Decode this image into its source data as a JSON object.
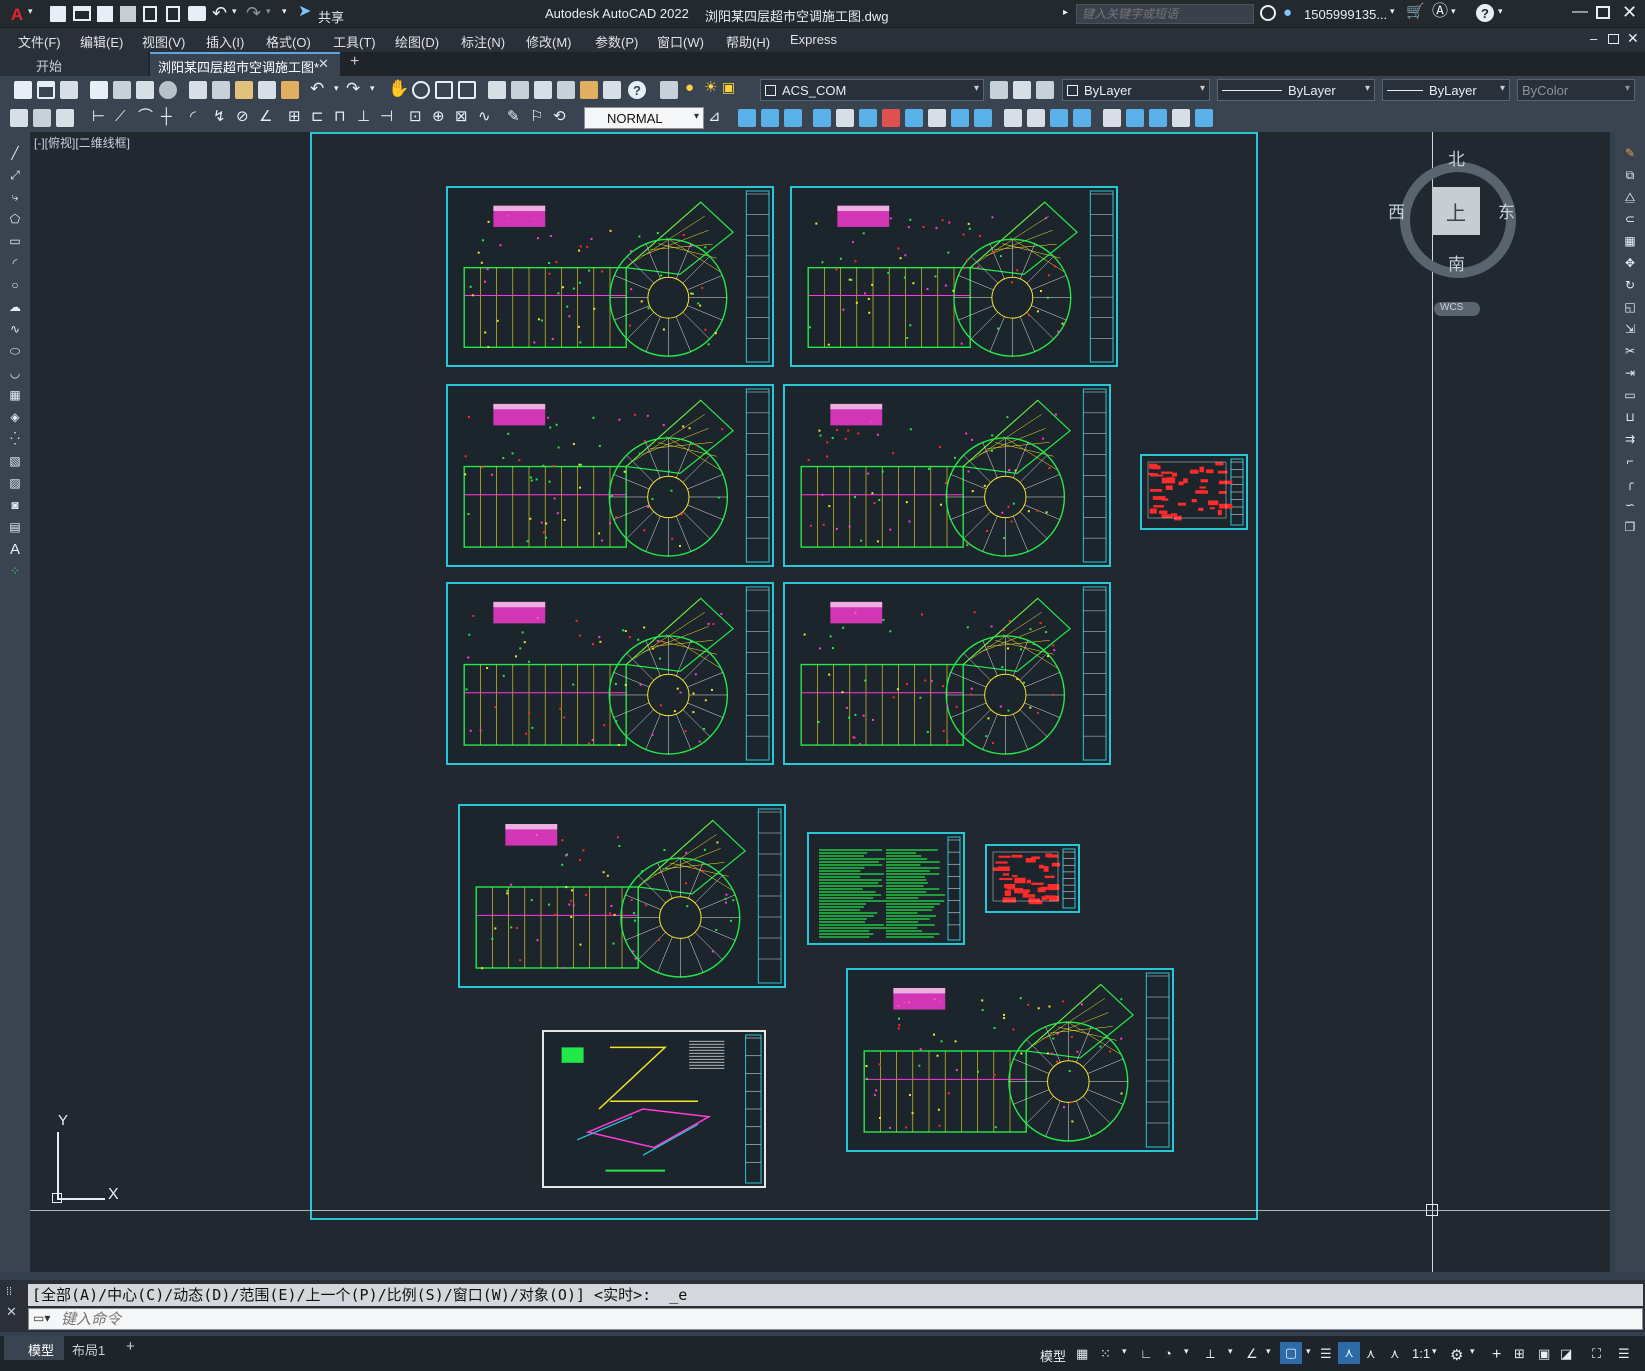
{
  "titlebar": {
    "app_logo": "A",
    "share_label": "共享",
    "app_title": "Autodesk AutoCAD 2022",
    "file_title": "浏阳某四层超市空调施工图.dwg",
    "search_placeholder": "键入关键字或短语",
    "user": "1505999135...",
    "icons": [
      "new-icon",
      "open-icon",
      "save-icon",
      "saveas-icon",
      "print-icon",
      "undo-icon",
      "redo-icon",
      "share-icon",
      "search-icon",
      "user-icon",
      "cart-icon",
      "help-icon",
      "minimize-icon",
      "maximize-icon",
      "close-icon"
    ]
  },
  "menubar": {
    "items": [
      "文件(F)",
      "编辑(E)",
      "视图(V)",
      "插入(I)",
      "格式(O)",
      "工具(T)",
      "绘图(D)",
      "标注(N)",
      "修改(M)",
      "参数(P)",
      "窗口(W)",
      "帮助(H)",
      "Express"
    ]
  },
  "tabs": {
    "start": "开始",
    "active": "浏阳某四层超市空调施工图*",
    "add": "+"
  },
  "toolbar": {
    "layer": "ACS_COM",
    "color": "ByLayer",
    "linetype": "ByLayer",
    "lineweight": "ByLayer",
    "plotstyle": "ByColor",
    "textstyle": "NORMAL"
  },
  "viewport": {
    "label": "[-][俯视][二维线框]",
    "viewcube": {
      "north": "北",
      "south": "南",
      "east": "东",
      "west": "西",
      "top": "上",
      "wcs": "WCS"
    },
    "ucs": {
      "x": "X",
      "y": "Y"
    }
  },
  "sheets": [
    {
      "type": "plan"
    },
    {
      "type": "plan"
    },
    {
      "type": "plan"
    },
    {
      "type": "plan"
    },
    {
      "type": "plan"
    },
    {
      "type": "plan"
    },
    {
      "type": "red-table"
    },
    {
      "type": "plan-small"
    },
    {
      "type": "text-table"
    },
    {
      "type": "red-table"
    },
    {
      "type": "plan"
    },
    {
      "type": "isometric"
    }
  ],
  "command": {
    "history": "[全部(A)/中心(C)/动态(D)/范围(E)/上一个(P)/比例(S)/窗口(W)/对象(O)] <实时>:  _e",
    "placeholder": "键入命令"
  },
  "status": {
    "tabs": [
      "模型",
      "布局1"
    ],
    "add": "+",
    "model": "模型",
    "scale": "1:1"
  },
  "colors": {
    "accent": "#27c7d6",
    "background": "#212830",
    "drawing_green": "#22e84a",
    "drawing_yellow": "#f2e42a",
    "drawing_magenta": "#ff3bd8",
    "drawing_red": "#ff2a2a"
  }
}
